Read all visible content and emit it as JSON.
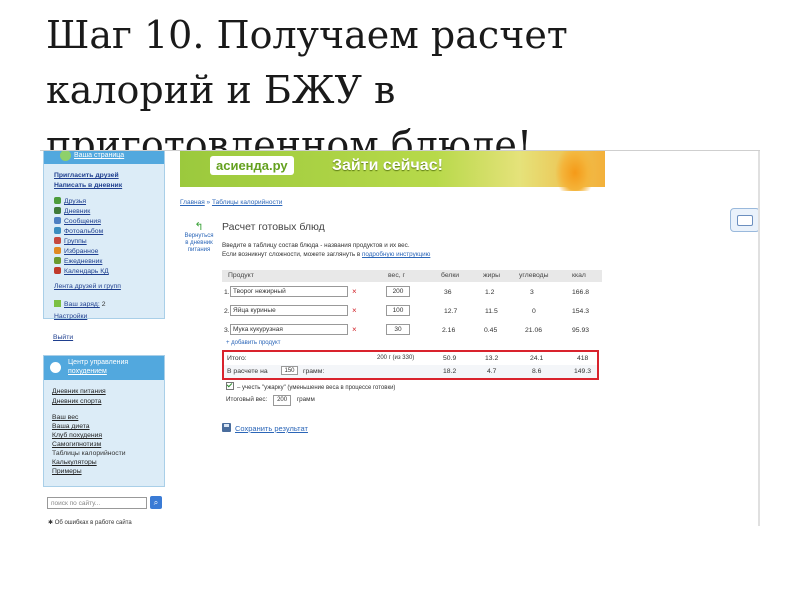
{
  "slide": {
    "title_line1": "Шаг 10. Получаем расчет",
    "title_line2": "калорий и БЖУ в",
    "title_line3": "приготовленном блюде!"
  },
  "sidebar": {
    "my_page": "Ваша страница",
    "invite": "Пригласить друзей",
    "write": "Написать в дневник",
    "items": [
      {
        "label": "Друзья",
        "color": "#4c9c3b"
      },
      {
        "label": "Дневник",
        "color": "#3f7a3a"
      },
      {
        "label": "Сообщения",
        "color": "#4d7fc2"
      },
      {
        "label": "Фотоальбом",
        "color": "#3b8dbf"
      },
      {
        "label": "Группы",
        "color": "#c6483e"
      },
      {
        "label": "Избранное",
        "color": "#e08a22"
      },
      {
        "label": "Ежедневник",
        "color": "#6b9a2f"
      },
      {
        "label": "Календарь КД",
        "color": "#c0392b"
      }
    ],
    "feed": "Лента друзей и групп",
    "charge_label": "Ваш заряд:",
    "charge_value": "2",
    "settings": "Настройки",
    "logout": "Выйти",
    "center_line1": "Центр управления",
    "center_line2": "похудением",
    "diary_food": "Дневник питания",
    "diary_sport": "Дневник спорта",
    "weight": "Ваш вес",
    "diet": "Ваша диета",
    "club": "Клуб похудения",
    "hypnosis": "Самогипнотизм",
    "calorie_table": "Таблицы калорийности",
    "calculators": "Калькуляторы",
    "recipes": "Примеры",
    "search_placeholder": "поиск по сайту...",
    "error_note": "Об ошибках в работе сайта"
  },
  "banner": {
    "logo": "асиенда.ру",
    "cta": "Зайти сейчас!"
  },
  "breadcrumb": {
    "home": "Главная",
    "sep": " » ",
    "current": "Таблицы калорийности"
  },
  "back": {
    "line1": "Вернуться",
    "line2": "в дневник",
    "line3": "питания"
  },
  "page": {
    "heading": "Расчет готовых блюд",
    "intro1": "Введите в таблицу состав блюда - названия продуктов и их вес.",
    "intro2": "Если возникнут сложности, можете заглянуть в ",
    "intro_link": "подробную инструкцию"
  },
  "table": {
    "headers": [
      "Продукт",
      "вес, г",
      "белки",
      "жиры",
      "углеводы",
      "ккал"
    ],
    "rows": [
      {
        "n": "1.",
        "product": "Творог нежирный",
        "weight": "200",
        "protein": "36",
        "fat": "1.2",
        "carbs": "3",
        "kcal": "166.8"
      },
      {
        "n": "2.",
        "product": "Яйца куриные",
        "weight": "100",
        "protein": "12.7",
        "fat": "11.5",
        "carbs": "0",
        "kcal": "154.3"
      },
      {
        "n": "3.",
        "product": "Мука кукурузная",
        "weight": "30",
        "protein": "2.16",
        "fat": "0.45",
        "carbs": "21.06",
        "kcal": "95.93"
      }
    ],
    "add_row": "+ добавить продукт"
  },
  "totals": {
    "label": "Итого:",
    "weight": "200 г (из 330)",
    "protein": "50.9",
    "fat": "13.2",
    "carbs": "24.1",
    "kcal": "418",
    "per_prefix": "В расчете на",
    "per_value": "150",
    "per_suffix": "грамм:",
    "per_protein": "18.2",
    "per_fat": "4.7",
    "per_carbs": "8.6",
    "per_kcal": "149.3"
  },
  "options": {
    "shrink_label": "– учесть \"ужарку\" (уменьшение веса в процессе готовки)",
    "final_label": "Итоговый вес:",
    "final_value": "200",
    "final_unit": "грамм",
    "save": "Сохранить результат"
  },
  "colors": {
    "accent_blue": "#52a8de",
    "highlight_red": "#d9232d",
    "link": "#2b66b8"
  }
}
